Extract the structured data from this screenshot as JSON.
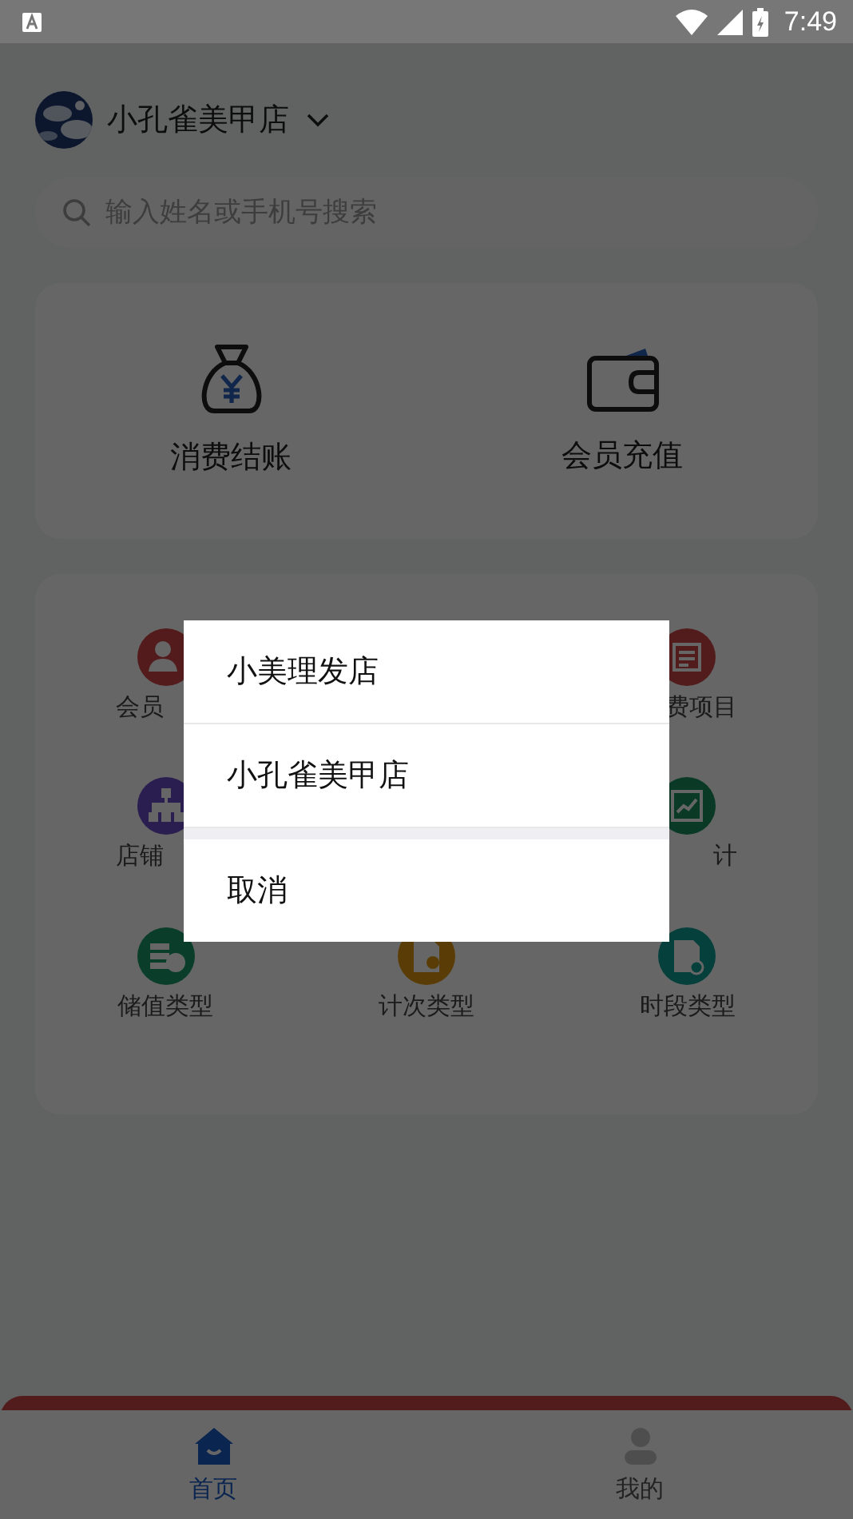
{
  "status_bar": {
    "time": "7:49"
  },
  "header": {
    "store_name": "小孔雀美甲店"
  },
  "search": {
    "placeholder": "输入姓名或手机号搜索"
  },
  "quick_actions": [
    {
      "label": "消费结账",
      "kind": "bag"
    },
    {
      "label": "会员充值",
      "kind": "wallet"
    }
  ],
  "menu_rows": [
    {
      "left": {
        "label": "会员",
        "kind": "members"
      },
      "right": {
        "label": "费项目",
        "kind": "list"
      }
    },
    {
      "left": {
        "label": "店铺",
        "kind": "tree"
      },
      "right": {
        "label": "计",
        "kind": "chart"
      }
    },
    {
      "left": {
        "label": "储值类型",
        "kind": "coins"
      },
      "center": {
        "label": "计次类型",
        "kind": "ticket"
      },
      "right": {
        "label": "时段类型",
        "kind": "doc"
      }
    }
  ],
  "dialog": {
    "options": [
      {
        "label": "小美理发店"
      },
      {
        "label": "小孔雀美甲店"
      }
    ],
    "cancel": "取消"
  },
  "bottom_nav": [
    {
      "label": "首页",
      "kind": "home",
      "selected": true
    },
    {
      "label": "我的",
      "kind": "user",
      "selected": false
    }
  ]
}
